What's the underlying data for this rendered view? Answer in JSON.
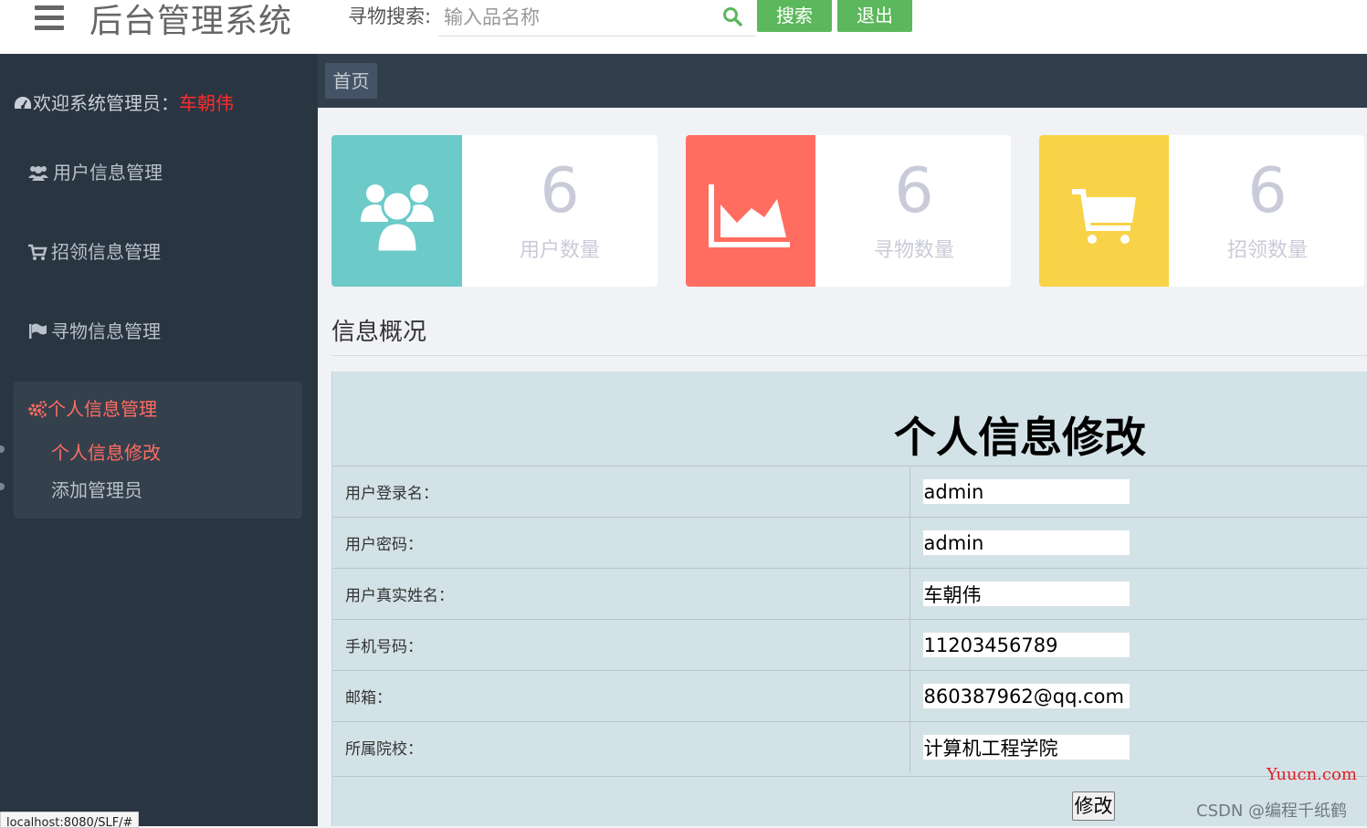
{
  "header": {
    "title": "后台管理系统",
    "search_label": "寻物搜索:",
    "search_placeholder": "输入品名称",
    "search_button": "搜索",
    "logout_button": "退出"
  },
  "sidebar": {
    "welcome_prefix": "欢迎系统管理员：",
    "admin_name": "车朝伟",
    "items": [
      {
        "label": "用户信息管理",
        "icon": "users-icon"
      },
      {
        "label": "招领信息管理",
        "icon": "cart-icon"
      },
      {
        "label": "寻物信息管理",
        "icon": "flag-icon"
      }
    ],
    "group": {
      "label": "个人信息管理",
      "icon": "cogs-icon",
      "children": [
        {
          "label": "个人信息修改",
          "active": true
        },
        {
          "label": "添加管理员",
          "active": false
        }
      ]
    }
  },
  "breadcrumb": "首页",
  "cards": [
    {
      "value": "6",
      "label": "用户数量",
      "color": "#6ccac9",
      "icon": "users-icon"
    },
    {
      "value": "6",
      "label": "寻物数量",
      "color": "#ff6c60",
      "icon": "area-chart-icon"
    },
    {
      "value": "6",
      "label": "招领数量",
      "color": "#f8d347",
      "icon": "cart-icon"
    }
  ],
  "section_title": "信息概况",
  "form": {
    "title": "个人信息修改",
    "fields": [
      {
        "label": "用户登录名：",
        "value": "admin"
      },
      {
        "label": "用户密码：",
        "value": "admin"
      },
      {
        "label": "用户真实姓名：",
        "value": "车朝伟"
      },
      {
        "label": "手机号码：",
        "value": "11203456789"
      },
      {
        "label": "邮箱：",
        "value": "860387962@qq.com"
      },
      {
        "label": "所属院校：",
        "value": "计算机工程学院"
      }
    ],
    "submit": "修改"
  },
  "watermarks": {
    "site": "Yuucn.com",
    "author": "CSDN @编程千纸鹤"
  },
  "status_url": "localhost:8080/SLF/#",
  "colors": {
    "sidebar_bg": "#2a3542",
    "accent_red": "#ff6c60",
    "button_green": "#5cb85c"
  }
}
